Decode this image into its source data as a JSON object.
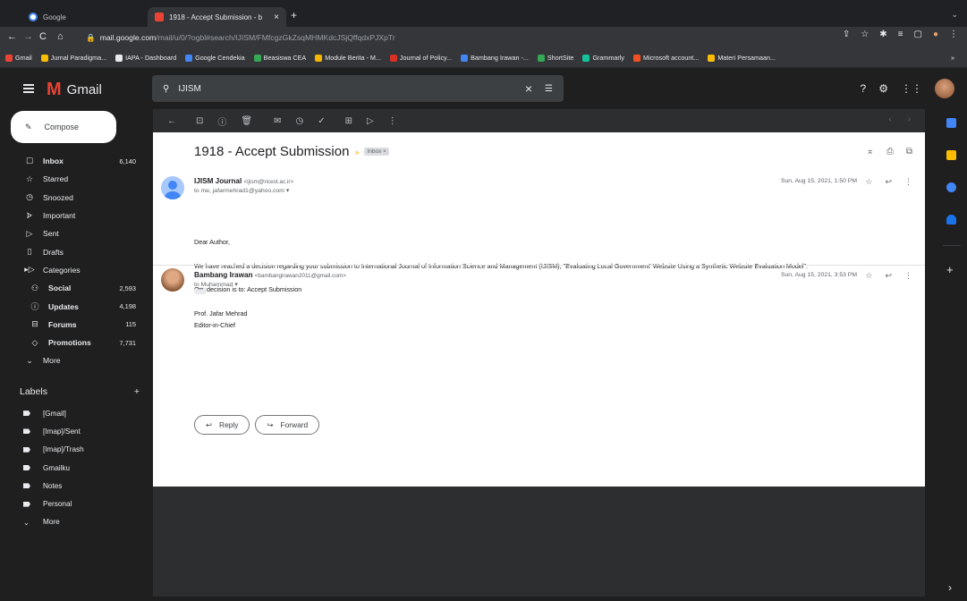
{
  "browser": {
    "tabs": [
      {
        "title": "Google",
        "close": "×"
      },
      {
        "title": "1918 - Accept Submission - b",
        "close": "×"
      }
    ],
    "newtab": "+",
    "url_host": "mail.google.com",
    "url_path": "/mail/u/0/?ogbl#search/IJISM/FMfcgzGkZsqMHMKdcJSjQffqdxPJXpTr",
    "bookmarks": [
      {
        "label": "Gmail",
        "color": "#ea4335"
      },
      {
        "label": "Jurnal Paradigma...",
        "color": "#fbbc04"
      },
      {
        "label": "IAPA - Dashboard",
        "color": "#e8eaed"
      },
      {
        "label": "Google Cendekia",
        "color": "#4285f4"
      },
      {
        "label": "Beasiswa CEA",
        "color": "#34a853"
      },
      {
        "label": "Module Berita - M...",
        "color": "#f4b400"
      },
      {
        "label": "Journal of Policy...",
        "color": "#d93025"
      },
      {
        "label": "Bambang Irawan -...",
        "color": "#4285f4"
      },
      {
        "label": "ShortSite",
        "color": "#34a853"
      },
      {
        "label": "Grammarly",
        "color": "#15c39a"
      },
      {
        "label": "Microsoft account...",
        "color": "#f25022"
      },
      {
        "label": "Materi Persamaan...",
        "color": "#fbbc04"
      }
    ],
    "bookmarks_more": "»"
  },
  "gmail": {
    "logo_text": "Gmail",
    "search_value": "IJISM",
    "compose": "Compose",
    "nav": [
      {
        "icon": "inbox-icon",
        "glyph": "☐",
        "label": "Inbox",
        "count": "6,140",
        "bold": true
      },
      {
        "icon": "star-icon",
        "glyph": "☆",
        "label": "Starred",
        "count": ""
      },
      {
        "icon": "clock-icon",
        "glyph": "◷",
        "label": "Snoozed",
        "count": ""
      },
      {
        "icon": "important-icon",
        "glyph": "ᗌ",
        "label": "Important",
        "count": ""
      },
      {
        "icon": "send-icon",
        "glyph": "▷",
        "label": "Sent",
        "count": ""
      },
      {
        "icon": "draft-icon",
        "glyph": "▯",
        "label": "Drafts",
        "count": ""
      },
      {
        "icon": "label-icon",
        "glyph": "▸▷",
        "label": "Categories",
        "count": ""
      },
      {
        "icon": "social-icon",
        "glyph": "⚇",
        "label": "Social",
        "count": "2,593",
        "bold": true,
        "sub": true
      },
      {
        "icon": "info-icon",
        "glyph": "ⓘ",
        "label": "Updates",
        "count": "4,198",
        "bold": true,
        "sub": true
      },
      {
        "icon": "forum-icon",
        "glyph": "⊟",
        "label": "Forums",
        "count": "115",
        "bold": true,
        "sub": true
      },
      {
        "icon": "tag-icon",
        "glyph": "◇",
        "label": "Promotions",
        "count": "7,731",
        "bold": true,
        "sub": true
      },
      {
        "icon": "chevron-down-icon",
        "glyph": "⌄",
        "label": "More",
        "count": ""
      }
    ],
    "labels_title": "Labels",
    "labels_add": "+",
    "labels": [
      "[Gmail]",
      "[Imap]/Sent",
      "[Imap]/Trash",
      "Gmailku",
      "Notes",
      "Personal"
    ],
    "labels_more": "More"
  },
  "thread": {
    "subject": "1918 - Accept Submission",
    "badge": "Inbox ×",
    "message1": {
      "sender": "IJISM Journal",
      "email": "<ijism@ricest.ac.ir>",
      "to": "to me, jafarmehrad1@yahoo.com ▾",
      "date": "Sun, Aug 15, 2021, 1:50 PM",
      "body": [
        "Dear Author,",
        "We have reached a decision regarding your submission to International Journal of Information Science and Management (IJISM), \"Evaluating Local Government' Website Using a Synthetic Website Evaluation Model\".",
        "Our decision is to:   Accept Submission",
        "Prof. Jafar Mehrad",
        "Editor-in-Chief"
      ]
    },
    "message2": {
      "sender": "Bambang Irawan",
      "email": "<bambangirawan2011@gmail.com>",
      "to": "to Muhammad ▾",
      "date": "Sun, Aug 15, 2021, 3:53 PM",
      "dots": "•••"
    },
    "reply": "Reply",
    "forward": "Forward"
  }
}
